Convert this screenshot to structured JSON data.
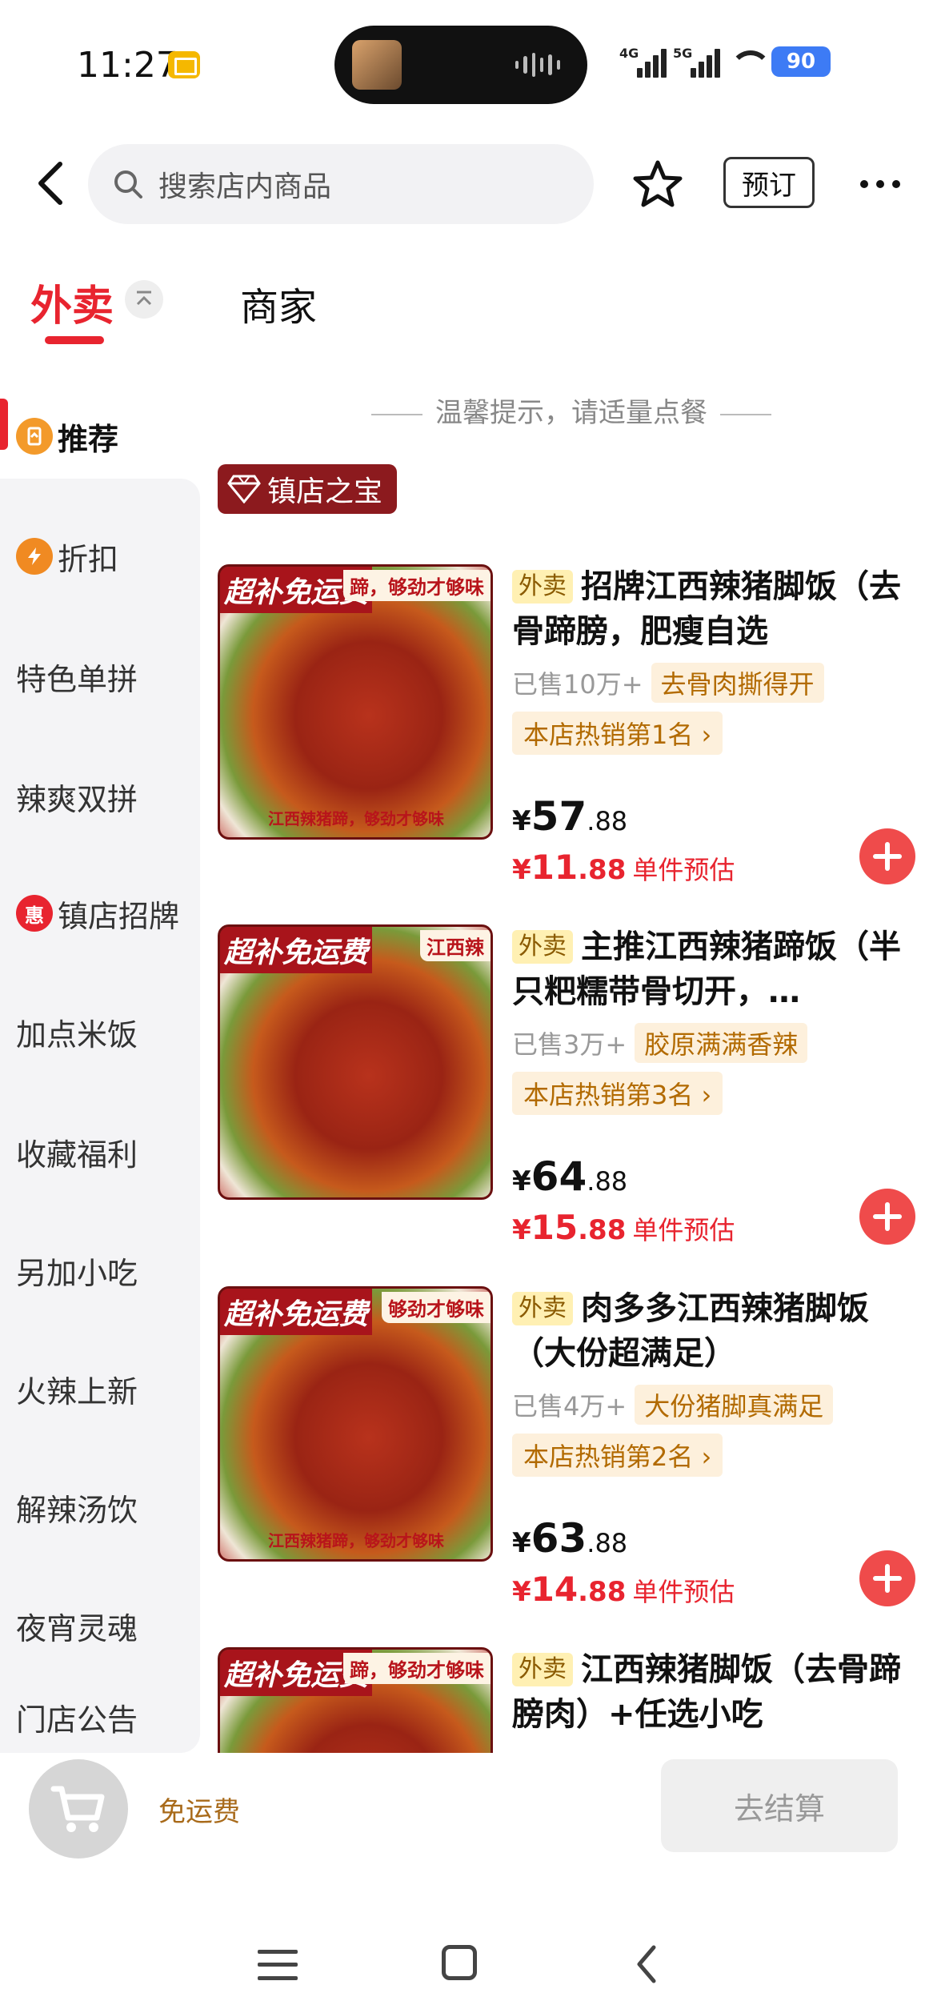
{
  "status_bar": {
    "time": "11:27",
    "net1": "4G",
    "net2": "5G",
    "battery": "90"
  },
  "header": {
    "search_placeholder": "搜索店内商品",
    "reserve_label": "预订"
  },
  "tabs": {
    "delivery": "外卖",
    "merchant": "商家"
  },
  "sidebar": {
    "items": [
      {
        "label": "推荐",
        "icon": "recommend-icon"
      },
      {
        "label": "折扣",
        "icon": "discount-icon"
      },
      {
        "label": "特色单拼"
      },
      {
        "label": "辣爽双拼"
      },
      {
        "label": "镇店招牌",
        "icon": "hui-icon",
        "icon_text": "惠"
      },
      {
        "label": "加点米饭"
      },
      {
        "label": "收藏福利"
      },
      {
        "label": "另加小吃"
      },
      {
        "label": "火辣上新"
      },
      {
        "label": "解辣汤饮"
      },
      {
        "label": "夜宵灵魂"
      },
      {
        "label": "门店公告"
      }
    ]
  },
  "content": {
    "tip": "温馨提示，请适量点餐",
    "section_tag": "镇店之宝",
    "products": [
      {
        "ribbon": "超补免运费",
        "rim_text": "蹄，够劲才够味",
        "plate_text": "江西辣猪蹄，够劲才够味",
        "badge": "外卖",
        "name": "招牌江西辣猪脚饭（去骨蹄膀，肥瘦自选",
        "sold": "已售10万+",
        "feature": "去骨肉撕得开",
        "rank": "本店热销第1名",
        "price_symbol": "¥",
        "price_int": "57",
        "price_dec": ".88",
        "est_symbol": "¥",
        "est_int": "11",
        "est_dec": ".88",
        "est_label": "单件预估"
      },
      {
        "ribbon": "超补免运费",
        "rim_text": "江西辣",
        "plate_text": "",
        "badge": "外卖",
        "name": "主推江西辣猪蹄饭（半只粑糯带骨切开，…",
        "sold": "已售3万+",
        "feature": "胶原满满香辣",
        "rank": "本店热销第3名",
        "price_symbol": "¥",
        "price_int": "64",
        "price_dec": ".88",
        "est_symbol": "¥",
        "est_int": "15",
        "est_dec": ".88",
        "est_label": "单件预估"
      },
      {
        "ribbon": "超补免运费",
        "rim_text": "够劲才够味",
        "plate_text": "江西辣猪蹄，够劲才够味",
        "badge": "外卖",
        "name": "肉多多江西辣猪脚饭（大份超满足）",
        "sold": "已售4万+",
        "feature": "大份猪脚真满足",
        "rank": "本店热销第2名",
        "price_symbol": "¥",
        "price_int": "63",
        "price_dec": ".88",
        "est_symbol": "¥",
        "est_int": "14",
        "est_dec": ".88",
        "est_label": "单件预估"
      },
      {
        "ribbon": "超补免运费",
        "rim_text": "蹄，够劲才够味",
        "plate_text": "",
        "badge": "外卖",
        "name": "江西辣猪脚饭（去骨蹄膀肉）+任选小吃"
      }
    ]
  },
  "cart": {
    "free_shipping": "免运费",
    "checkout": "去结算"
  },
  "colors": {
    "accent": "#e8242f",
    "tag_bg": "#8c1a1e",
    "badge_bg": "#fff0b3",
    "feature_text": "#b26a00"
  }
}
